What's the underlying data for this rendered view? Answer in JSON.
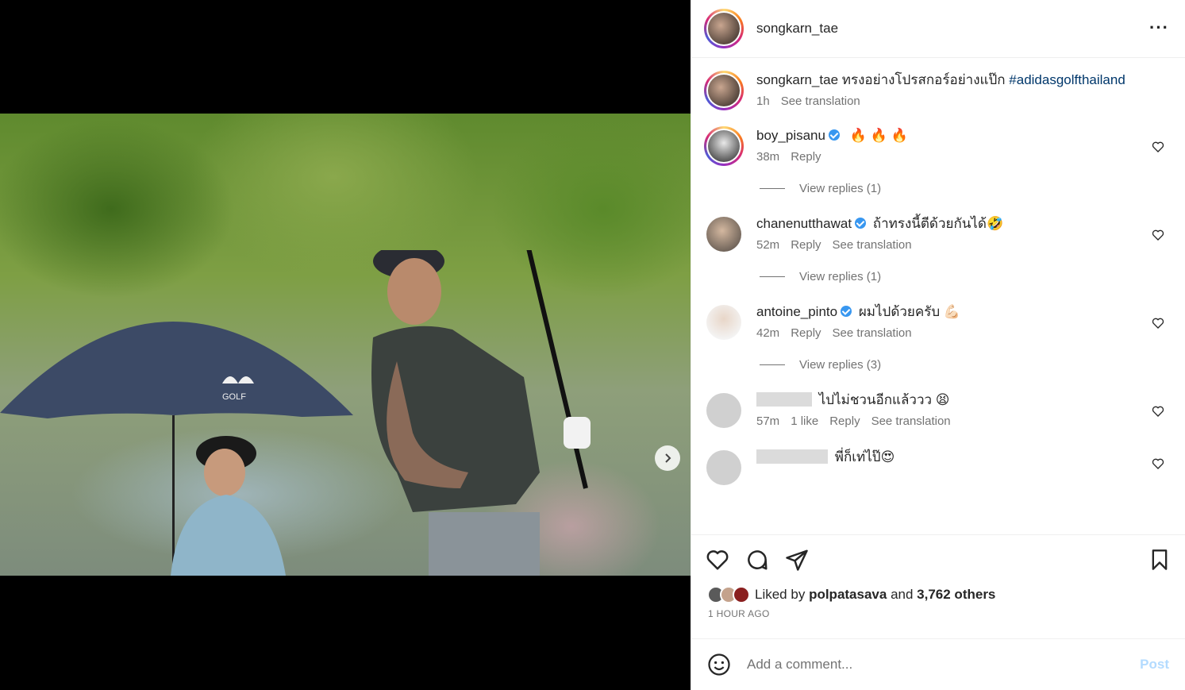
{
  "post": {
    "author": "songkarn_tae",
    "more_icon": "more-horizontal-icon"
  },
  "caption": {
    "user": "songkarn_tae",
    "text": "ทรงอย่างโปรสกอร์อย่างแป๊ก",
    "hashtag": "#adidasgolfthailand",
    "time": "1h",
    "see_translation": "See translation"
  },
  "comments": [
    {
      "user": "boy_pisanu",
      "verified": true,
      "text": "🔥 🔥 🔥",
      "time": "38m",
      "likes": "",
      "reply": "Reply",
      "translate": "",
      "view_replies": "View replies (1)"
    },
    {
      "user": "chanenutthawat",
      "verified": true,
      "text": "ถ้าทรงนี้ตีด้วยกันได้🤣",
      "time": "52m",
      "likes": "",
      "reply": "Reply",
      "translate": "See translation",
      "view_replies": "View replies (1)"
    },
    {
      "user": "antoine_pinto",
      "verified": true,
      "text": "ผมไปด้วยครับ 💪🏻",
      "time": "42m",
      "likes": "",
      "reply": "Reply",
      "translate": "See translation",
      "view_replies": "View replies (3)"
    },
    {
      "user": "",
      "verified": false,
      "text": "ไปไม่ชวนอีกแล้ววว 😫",
      "time": "57m",
      "likes": "1 like",
      "reply": "Reply",
      "translate": "See translation",
      "view_replies": ""
    },
    {
      "user": "",
      "verified": false,
      "text": "พี่ก็เท่ไป๊😍",
      "time": "",
      "likes": "",
      "reply": "",
      "translate": "",
      "view_replies": ""
    }
  ],
  "likes": {
    "prefix": "Liked by",
    "first_user": "polpatasava",
    "and": "and",
    "others": "3,762 others"
  },
  "timestamp": "1 HOUR AGO",
  "comment_box": {
    "placeholder": "Add a comment...",
    "post_label": "Post"
  },
  "carousel": {
    "slides": 4,
    "active": 1
  },
  "colors": {
    "link": "#00376b",
    "verified": "#3897f0",
    "post_disabled": "#b3dbff"
  }
}
